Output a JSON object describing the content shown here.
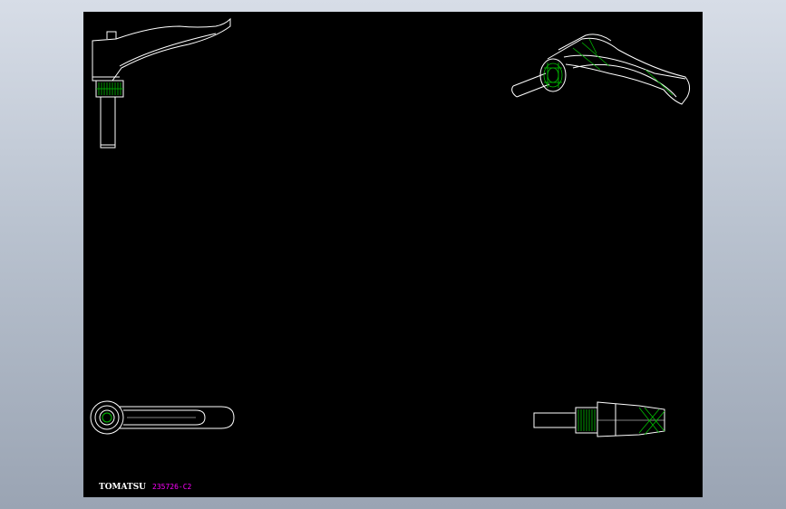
{
  "drawing": {
    "brand_label": "TOMATSU",
    "part_number": "235726-C2"
  },
  "colors": {
    "background_outer": "#b9c2cf",
    "canvas": "#000000",
    "line_primary": "#ffffff",
    "line_detail": "#00c000",
    "part_number_text": "#ff00ff"
  }
}
